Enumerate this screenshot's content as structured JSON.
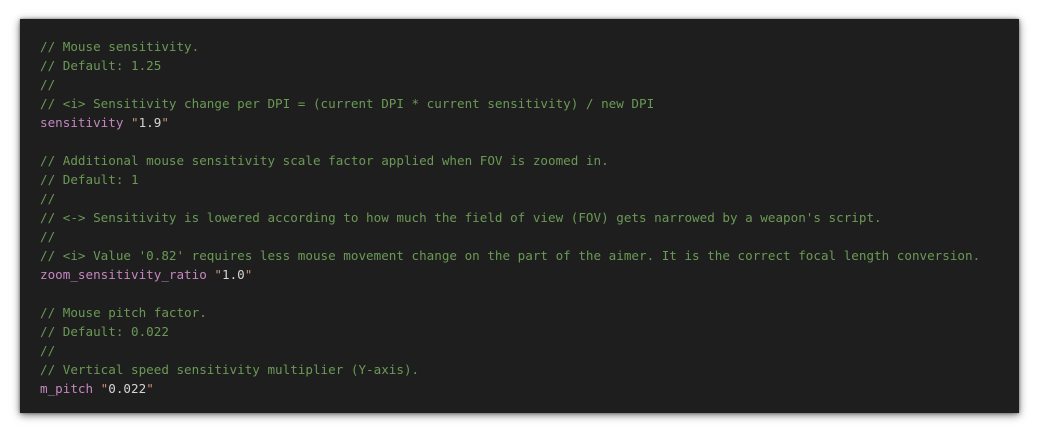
{
  "code_lines": [
    {
      "type": "comment",
      "text": "// Mouse sensitivity."
    },
    {
      "type": "comment",
      "text": "// Default: 1.25"
    },
    {
      "type": "comment",
      "text": "//"
    },
    {
      "type": "comment",
      "text": "// <i> Sensitivity change per DPI = (current DPI * current sensitivity) / new DPI"
    },
    {
      "type": "setting",
      "key": "sensitivity",
      "value": "1.9"
    },
    {
      "type": "blank",
      "text": ""
    },
    {
      "type": "comment",
      "text": "// Additional mouse sensitivity scale factor applied when FOV is zoomed in."
    },
    {
      "type": "comment",
      "text": "// Default: 1"
    },
    {
      "type": "comment",
      "text": "//"
    },
    {
      "type": "comment",
      "text": "// <-> Sensitivity is lowered according to how much the field of view (FOV) gets narrowed by a weapon's script."
    },
    {
      "type": "comment",
      "text": "//"
    },
    {
      "type": "comment",
      "text": "// <i> Value '0.82' requires less mouse movement change on the part of the aimer. It is the correct focal length conversion."
    },
    {
      "type": "setting",
      "key": "zoom_sensitivity_ratio",
      "value": "1.0"
    },
    {
      "type": "blank",
      "text": ""
    },
    {
      "type": "comment",
      "text": "// Mouse pitch factor."
    },
    {
      "type": "comment",
      "text": "// Default: 0.022"
    },
    {
      "type": "comment",
      "text": "//"
    },
    {
      "type": "comment",
      "text": "// Vertical speed sensitivity multiplier (Y-axis)."
    },
    {
      "type": "setting",
      "key": "m_pitch",
      "value": "0.022"
    }
  ],
  "colors": {
    "background": "#1e1e1e",
    "comment": "#6a9955",
    "key": "#c586c0",
    "string": "#ce9178"
  }
}
